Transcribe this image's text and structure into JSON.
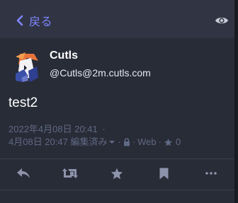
{
  "header": {
    "back_label": "戻る",
    "back_icon": "chevron-left-icon",
    "visibility_icon": "eye-icon"
  },
  "status": {
    "display_name": "Cutls",
    "account": "@Cutls@2m.cutls.com",
    "content": "test2",
    "created": "2022年4月08日 20:41",
    "created_sep": "·",
    "edited": "4月08日 20:47 編集済み",
    "visibility_icon": "lock-icon",
    "application": "Web",
    "favourites_count": "0",
    "colors": {
      "accent": "#7f86ff",
      "meta": "#606984",
      "background": "#282c37",
      "header": "#313543"
    }
  },
  "actions": {
    "reply_icon": "reply-icon",
    "boost_icon": "boost-icon",
    "favourite_icon": "star-icon",
    "bookmark_icon": "bookmark-icon",
    "more_icon": "ellipsis-icon"
  }
}
